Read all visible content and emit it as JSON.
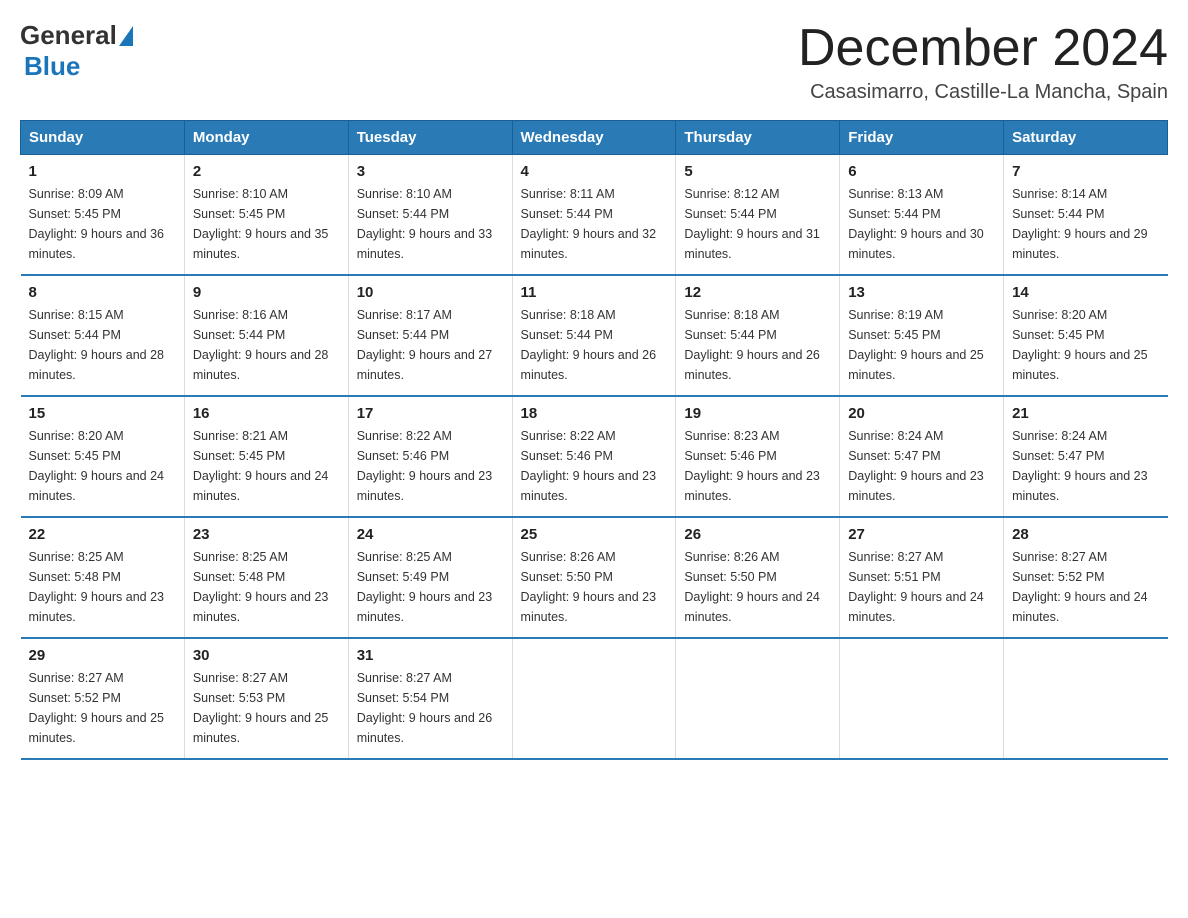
{
  "logo": {
    "general": "General",
    "blue": "Blue"
  },
  "header": {
    "month": "December 2024",
    "location": "Casasimarro, Castille-La Mancha, Spain"
  },
  "weekdays": [
    "Sunday",
    "Monday",
    "Tuesday",
    "Wednesday",
    "Thursday",
    "Friday",
    "Saturday"
  ],
  "weeks": [
    [
      {
        "day": "1",
        "sunrise": "8:09 AM",
        "sunset": "5:45 PM",
        "daylight": "9 hours and 36 minutes."
      },
      {
        "day": "2",
        "sunrise": "8:10 AM",
        "sunset": "5:45 PM",
        "daylight": "9 hours and 35 minutes."
      },
      {
        "day": "3",
        "sunrise": "8:10 AM",
        "sunset": "5:44 PM",
        "daylight": "9 hours and 33 minutes."
      },
      {
        "day": "4",
        "sunrise": "8:11 AM",
        "sunset": "5:44 PM",
        "daylight": "9 hours and 32 minutes."
      },
      {
        "day": "5",
        "sunrise": "8:12 AM",
        "sunset": "5:44 PM",
        "daylight": "9 hours and 31 minutes."
      },
      {
        "day": "6",
        "sunrise": "8:13 AM",
        "sunset": "5:44 PM",
        "daylight": "9 hours and 30 minutes."
      },
      {
        "day": "7",
        "sunrise": "8:14 AM",
        "sunset": "5:44 PM",
        "daylight": "9 hours and 29 minutes."
      }
    ],
    [
      {
        "day": "8",
        "sunrise": "8:15 AM",
        "sunset": "5:44 PM",
        "daylight": "9 hours and 28 minutes."
      },
      {
        "day": "9",
        "sunrise": "8:16 AM",
        "sunset": "5:44 PM",
        "daylight": "9 hours and 28 minutes."
      },
      {
        "day": "10",
        "sunrise": "8:17 AM",
        "sunset": "5:44 PM",
        "daylight": "9 hours and 27 minutes."
      },
      {
        "day": "11",
        "sunrise": "8:18 AM",
        "sunset": "5:44 PM",
        "daylight": "9 hours and 26 minutes."
      },
      {
        "day": "12",
        "sunrise": "8:18 AM",
        "sunset": "5:44 PM",
        "daylight": "9 hours and 26 minutes."
      },
      {
        "day": "13",
        "sunrise": "8:19 AM",
        "sunset": "5:45 PM",
        "daylight": "9 hours and 25 minutes."
      },
      {
        "day": "14",
        "sunrise": "8:20 AM",
        "sunset": "5:45 PM",
        "daylight": "9 hours and 25 minutes."
      }
    ],
    [
      {
        "day": "15",
        "sunrise": "8:20 AM",
        "sunset": "5:45 PM",
        "daylight": "9 hours and 24 minutes."
      },
      {
        "day": "16",
        "sunrise": "8:21 AM",
        "sunset": "5:45 PM",
        "daylight": "9 hours and 24 minutes."
      },
      {
        "day": "17",
        "sunrise": "8:22 AM",
        "sunset": "5:46 PM",
        "daylight": "9 hours and 23 minutes."
      },
      {
        "day": "18",
        "sunrise": "8:22 AM",
        "sunset": "5:46 PM",
        "daylight": "9 hours and 23 minutes."
      },
      {
        "day": "19",
        "sunrise": "8:23 AM",
        "sunset": "5:46 PM",
        "daylight": "9 hours and 23 minutes."
      },
      {
        "day": "20",
        "sunrise": "8:24 AM",
        "sunset": "5:47 PM",
        "daylight": "9 hours and 23 minutes."
      },
      {
        "day": "21",
        "sunrise": "8:24 AM",
        "sunset": "5:47 PM",
        "daylight": "9 hours and 23 minutes."
      }
    ],
    [
      {
        "day": "22",
        "sunrise": "8:25 AM",
        "sunset": "5:48 PM",
        "daylight": "9 hours and 23 minutes."
      },
      {
        "day": "23",
        "sunrise": "8:25 AM",
        "sunset": "5:48 PM",
        "daylight": "9 hours and 23 minutes."
      },
      {
        "day": "24",
        "sunrise": "8:25 AM",
        "sunset": "5:49 PM",
        "daylight": "9 hours and 23 minutes."
      },
      {
        "day": "25",
        "sunrise": "8:26 AM",
        "sunset": "5:50 PM",
        "daylight": "9 hours and 23 minutes."
      },
      {
        "day": "26",
        "sunrise": "8:26 AM",
        "sunset": "5:50 PM",
        "daylight": "9 hours and 24 minutes."
      },
      {
        "day": "27",
        "sunrise": "8:27 AM",
        "sunset": "5:51 PM",
        "daylight": "9 hours and 24 minutes."
      },
      {
        "day": "28",
        "sunrise": "8:27 AM",
        "sunset": "5:52 PM",
        "daylight": "9 hours and 24 minutes."
      }
    ],
    [
      {
        "day": "29",
        "sunrise": "8:27 AM",
        "sunset": "5:52 PM",
        "daylight": "9 hours and 25 minutes."
      },
      {
        "day": "30",
        "sunrise": "8:27 AM",
        "sunset": "5:53 PM",
        "daylight": "9 hours and 25 minutes."
      },
      {
        "day": "31",
        "sunrise": "8:27 AM",
        "sunset": "5:54 PM",
        "daylight": "9 hours and 26 minutes."
      },
      null,
      null,
      null,
      null
    ]
  ]
}
